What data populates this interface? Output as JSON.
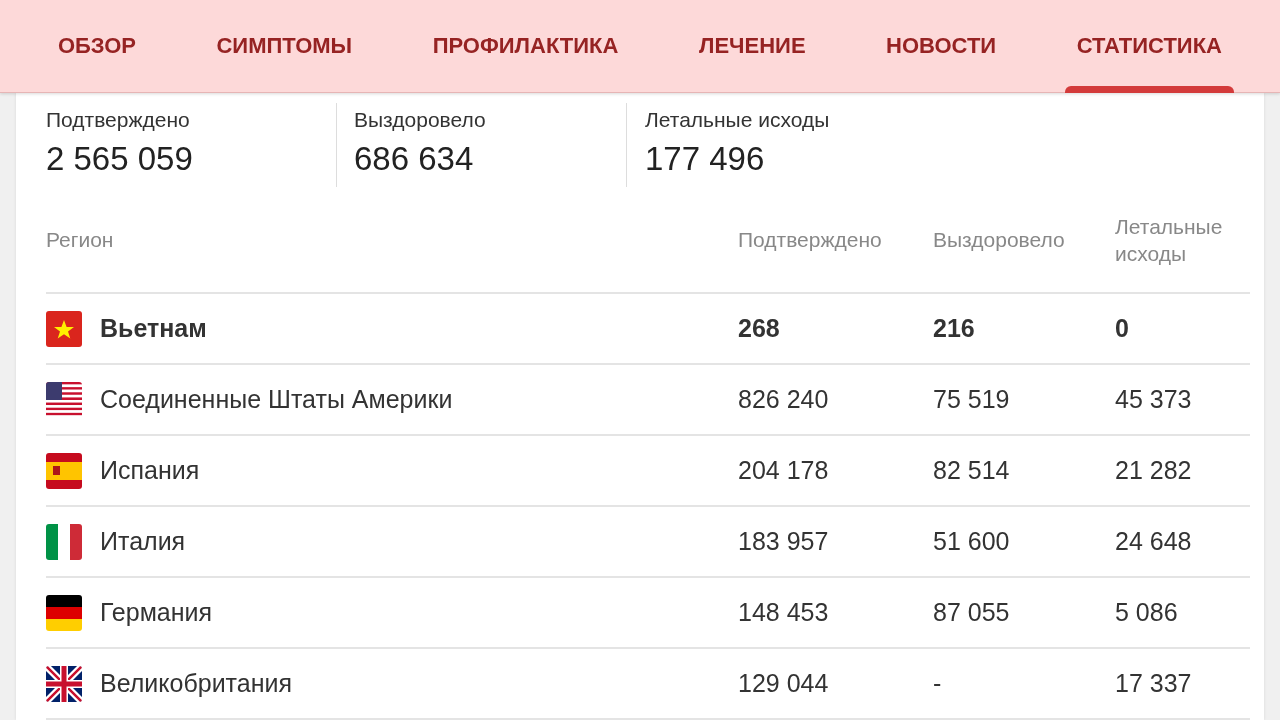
{
  "tabs": [
    {
      "label": "ОБЗОР",
      "selected": false
    },
    {
      "label": "СИМПТОМЫ",
      "selected": false
    },
    {
      "label": "ПРОФИЛАКТИКА",
      "selected": false
    },
    {
      "label": "ЛЕЧЕНИЕ",
      "selected": false
    },
    {
      "label": "НОВОСТИ",
      "selected": false
    },
    {
      "label": "СТАТИСТИКА",
      "selected": true
    }
  ],
  "summary": [
    {
      "label": "Подтверждено",
      "value": "2 565 059"
    },
    {
      "label": "Выздоровело",
      "value": "686 634"
    },
    {
      "label": "Летальные исходы",
      "value": "177 496"
    }
  ],
  "table": {
    "columns": [
      "Регион",
      "Подтверждено",
      "Выздоровело",
      "Летальные исходы"
    ],
    "rows": [
      {
        "kind": "vn",
        "region": "Вьетнам",
        "confirmed": "268",
        "recovered": "216",
        "deaths": "0",
        "highlighted": true
      },
      {
        "kind": "us",
        "region": "Соединенные Штаты Америки",
        "confirmed": "826 240",
        "recovered": "75 519",
        "deaths": "45 373",
        "highlighted": false
      },
      {
        "kind": "es",
        "region": "Испания",
        "confirmed": "204 178",
        "recovered": "82 514",
        "deaths": "21 282",
        "highlighted": false
      },
      {
        "kind": "it",
        "region": "Италия",
        "confirmed": "183 957",
        "recovered": "51 600",
        "deaths": "24 648",
        "highlighted": false
      },
      {
        "kind": "de",
        "region": "Германия",
        "confirmed": "148 453",
        "recovered": "87 055",
        "deaths": "5 086",
        "highlighted": false
      },
      {
        "kind": "gb",
        "region": "Великобритания",
        "confirmed": "129 044",
        "recovered": "-",
        "deaths": "17 337",
        "highlighted": false
      }
    ]
  }
}
